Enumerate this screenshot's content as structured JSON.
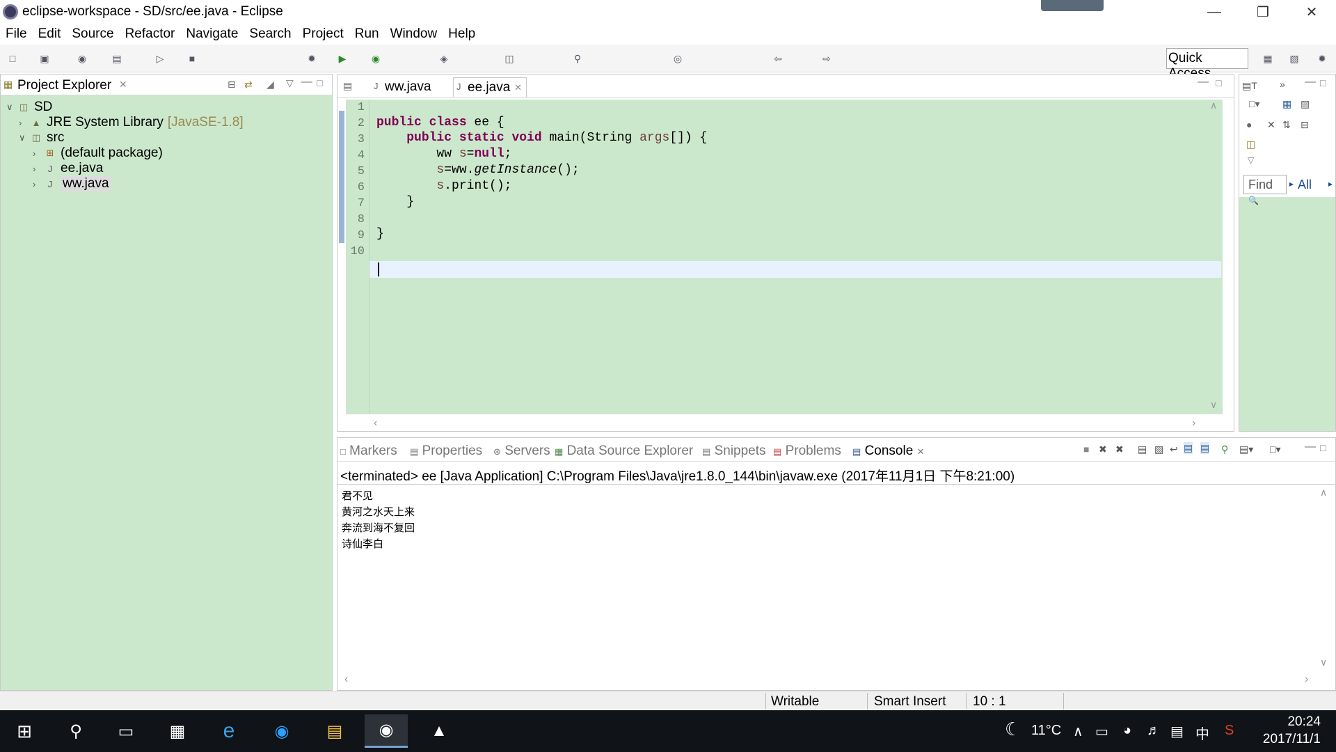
{
  "window": {
    "title": "eclipse-workspace - SD/src/ee.java - Eclipse"
  },
  "menu": [
    "File",
    "Edit",
    "Source",
    "Refactor",
    "Navigate",
    "Search",
    "Project",
    "Run",
    "Window",
    "Help"
  ],
  "toolbar": {
    "quick_access": "Quick Access"
  },
  "project_explorer": {
    "title": "Project Explorer",
    "tree": [
      {
        "label": "SD",
        "decor": ""
      },
      {
        "label": "JRE System Library",
        "decor": "[JavaSE-1.8]"
      },
      {
        "label": "src",
        "decor": ""
      },
      {
        "label": "(default package)",
        "decor": ""
      },
      {
        "label": "ee.java",
        "decor": ""
      },
      {
        "label": "ww.java",
        "decor": ""
      }
    ]
  },
  "editor": {
    "tabs": [
      "ww.java",
      "ee.java"
    ],
    "active_tab": "ee.java",
    "line_numbers": [
      "1",
      "2",
      "3",
      "4",
      "5",
      "6",
      "7",
      "8",
      "9",
      "10"
    ]
  },
  "outline": {
    "find_placeholder": "Find",
    "all_label": "All"
  },
  "bottom_panel": {
    "tabs": [
      "Markers",
      "Properties",
      "Servers",
      "Data Source Explorer",
      "Snippets",
      "Problems",
      "Console"
    ],
    "active_tab": "Console",
    "terminated": "<terminated> ee [Java Application] C:\\Program Files\\Java\\jre1.8.0_144\\bin\\javaw.exe (2017年11月1日 下午8:21:00)",
    "output": [
      "君不见",
      "黄河之水天上来",
      "奔流到海不复回",
      "诗仙李白"
    ]
  },
  "status": {
    "writable": "Writable",
    "insert_mode": "Smart Insert",
    "position": "10 : 1"
  },
  "taskbar": {
    "weather": "11°C",
    "ime": "中",
    "time": "20:24",
    "date": "2017/11/1"
  }
}
